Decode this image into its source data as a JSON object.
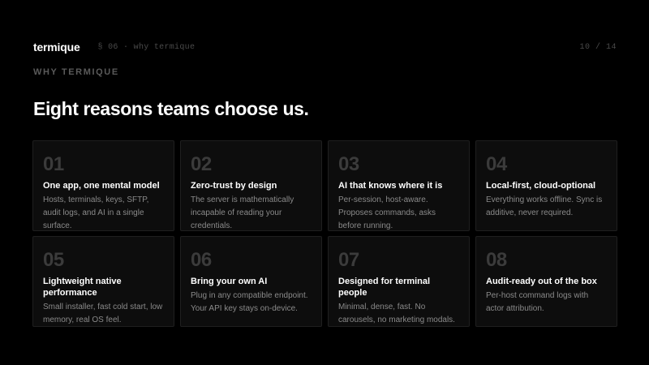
{
  "header": {
    "brand": "termique",
    "section": "§ 06 · why termique",
    "page": "10 / 14"
  },
  "eyebrow": "WHY TERMIQUE",
  "headline": "Eight reasons teams choose us.",
  "cards": [
    {
      "num": "01",
      "title": "One app, one mental model",
      "desc": "Hosts, terminals, keys, SFTP, audit logs, and AI in a single surface."
    },
    {
      "num": "02",
      "title": "Zero-trust by design",
      "desc": "The server is mathematically incapable of reading your credentials."
    },
    {
      "num": "03",
      "title": "AI that knows where it is",
      "desc": "Per-session, host-aware. Proposes commands, asks before running."
    },
    {
      "num": "04",
      "title": "Local-first, cloud-optional",
      "desc": "Everything works offline. Sync is additive, never required."
    },
    {
      "num": "05",
      "title": "Lightweight native performance",
      "desc": "Small installer, fast cold start, low memory, real OS feel."
    },
    {
      "num": "06",
      "title": "Bring your own AI",
      "desc": "Plug in any compatible endpoint. Your API key stays on-device."
    },
    {
      "num": "07",
      "title": "Designed for terminal people",
      "desc": "Minimal, dense, fast. No carousels, no marketing modals."
    },
    {
      "num": "08",
      "title": "Audit-ready out of the box",
      "desc": "Per-host command logs with actor attribution."
    }
  ]
}
